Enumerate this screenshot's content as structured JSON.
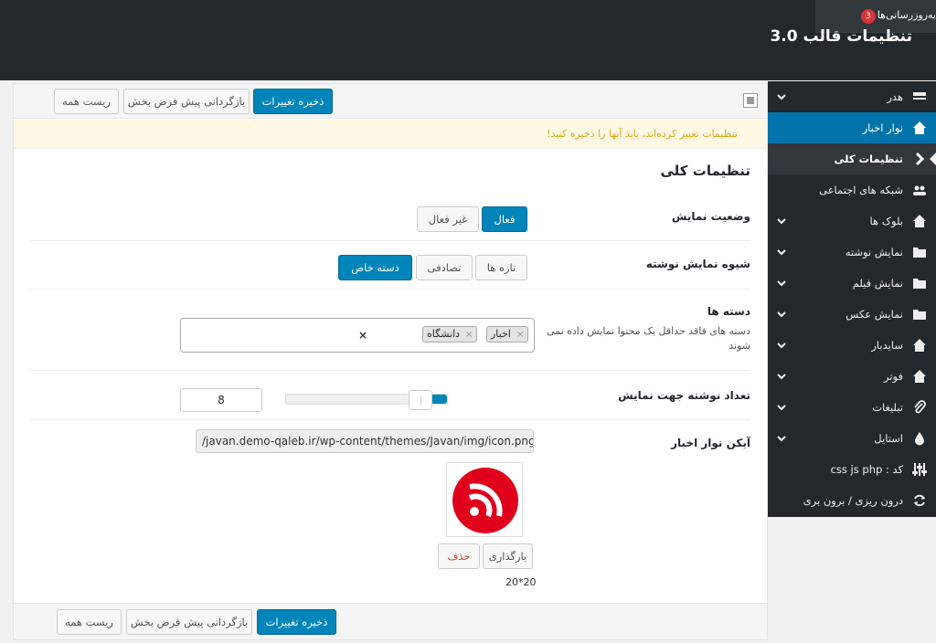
{
  "admin_bar": {
    "updates_label": "به‌روزرسانی‌ها",
    "updates_count": "3"
  },
  "page": {
    "title": "تنظیمات قالب 3.0"
  },
  "toolbar": {
    "save_label": "ذخیره تغییرات",
    "reset_section_label": "بازگردانی پیش فرض بخش",
    "reset_all_label": "ریست همه"
  },
  "notice": {
    "text": "تنظیمات تغییر کرده‌اند، باید آنها را ذخیره کنید!"
  },
  "section": {
    "title": "تنظیمات کلی"
  },
  "fields": {
    "display_status": {
      "label": "وضعیت نمایش",
      "options": [
        "فعال",
        "غیر فعال"
      ],
      "selected": "فعال"
    },
    "post_display_mode": {
      "label": "شیوه نمایش نوشته",
      "options": [
        "تازه ها",
        "تصادفی",
        "دسته خاص"
      ],
      "selected": "دسته خاص"
    },
    "categories": {
      "label": "دسته ها",
      "description": "دسته های فاقد حداقل یک محتوا نمایش داده نمی شوند",
      "selected_tags": [
        "اخبار",
        "دانشگاه"
      ],
      "clear_symbol": "×",
      "tag_remove_symbol": "×"
    },
    "post_count": {
      "label": "تعداد نوشته جهت نمایش",
      "value": "8",
      "slider_fraction": 0.1
    },
    "news_icon": {
      "label": "آیکن نوار اخبار",
      "url": "/javan.demo-qaleb.ir/wp-content/themes/Javan/img/icon.png",
      "upload_label": "بارگذاری",
      "delete_label": "حذف",
      "size_text": "20*20"
    }
  },
  "sidebar": {
    "items": [
      {
        "label": "هدر",
        "icon": "header-icon",
        "chevron": true
      },
      {
        "label": "نوار اخبار",
        "icon": "home-icon",
        "chevron": false
      },
      {
        "label": "تنظیمات کلی",
        "icon": "chevron-right-icon",
        "chevron": false
      },
      {
        "label": "شبکه های اجتماعی",
        "icon": "users-icon",
        "chevron": false
      },
      {
        "label": "بلوک ها",
        "icon": "home-icon",
        "chevron": true
      },
      {
        "label": "نمایش نوشته",
        "icon": "folder-icon",
        "chevron": true
      },
      {
        "label": "نمایش فیلم",
        "icon": "folder-icon",
        "chevron": true
      },
      {
        "label": "نمایش عکس",
        "icon": "folder-icon",
        "chevron": true
      },
      {
        "label": "سایدبار",
        "icon": "home-icon",
        "chevron": true
      },
      {
        "label": "فوتر",
        "icon": "home-icon",
        "chevron": true
      },
      {
        "label": "تبلیغات",
        "icon": "paperclip-icon",
        "chevron": true
      },
      {
        "label": "استایل",
        "icon": "drop-icon",
        "chevron": true
      },
      {
        "label": "کد : css js php",
        "icon": "sliders-icon",
        "chevron": false
      },
      {
        "label": "درون ریزی / برون بری",
        "icon": "refresh-icon",
        "chevron": false
      }
    ]
  },
  "colors": {
    "primary": "#0085ba",
    "sidebar_bg": "#23282d",
    "notice_text": "#dba617",
    "rss_red": "#e0001b"
  }
}
